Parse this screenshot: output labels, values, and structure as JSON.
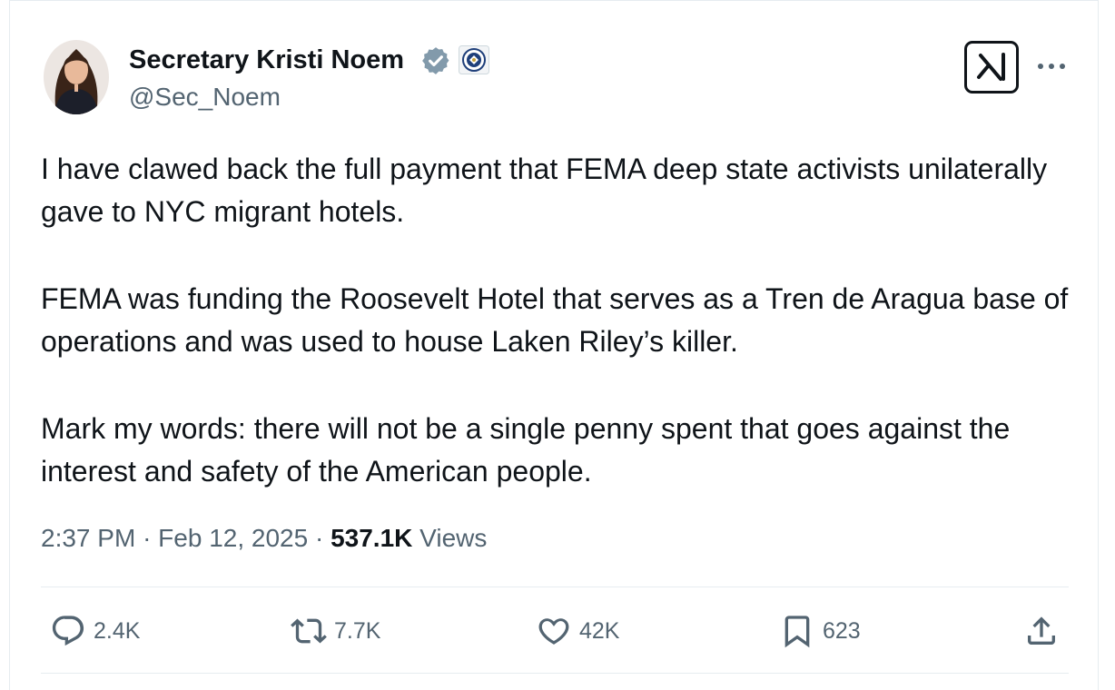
{
  "author": {
    "name": "Secretary Kristi Noem",
    "handle": "@Sec_Noem"
  },
  "tweet": {
    "paragraphs": [
      "I have clawed back the full payment that FEMA deep state activists unilaterally gave to NYC migrant hotels.",
      "FEMA was funding the Roosevelt Hotel that serves as a Tren de Aragua base of operations and was used to house Laken Riley’s killer.",
      "Mark my words: there will not be a single penny spent that goes against the interest and safety of the American people."
    ],
    "time": "2:37 PM",
    "date": "Feb 12, 2025",
    "separator": "·",
    "views_count": "537.1K",
    "views_label": "Views"
  },
  "actions": {
    "replies": "2.4K",
    "reposts": "7.7K",
    "likes": "42K",
    "bookmarks": "623"
  },
  "icons": {
    "verified": "verified-badge-icon",
    "affiliate": "dhs-seal-icon",
    "grok": "grok-icon",
    "more": "more-icon",
    "reply": "reply-icon",
    "repost": "repost-icon",
    "like": "like-icon",
    "bookmark": "bookmark-icon",
    "share": "share-icon"
  },
  "colors": {
    "text": "#0f1419",
    "secondary": "#536471",
    "verified_badge": "#829aab",
    "border": "#e6ecf0"
  }
}
